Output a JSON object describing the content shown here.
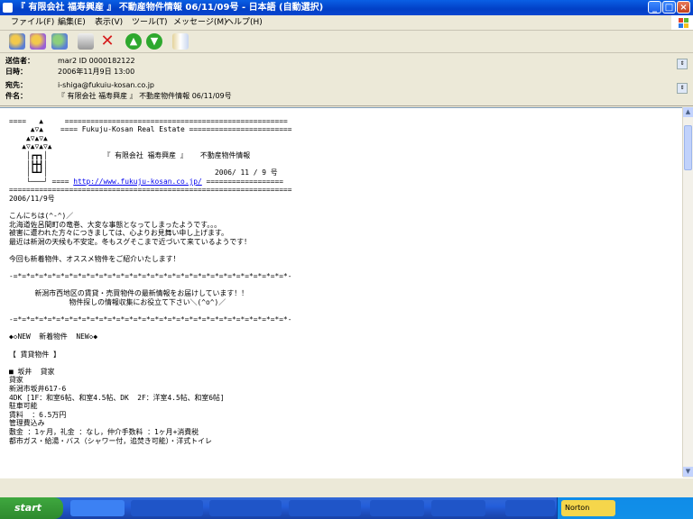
{
  "window": {
    "title": "『 有限会社 福寿興産 』 不動産物件情報 06/11/09号 - 日本語 (自動選択)"
  },
  "menu": [
    "ファイル(F)",
    "編集(E)",
    "表示(V)",
    "ツール(T)",
    "メッセージ(M)",
    "ヘルプ(H)"
  ],
  "header": {
    "from_label": "送信者：",
    "from_value": "mar2 ID 0000182122",
    "date_label": "日時：",
    "date_value": "2006年11月9日 13:00",
    "to_label": "宛先：",
    "to_value": "i-shiga@fukuiu-kosan.co.jp",
    "subject_label": "件名：",
    "subject_value": "『 有限会社 福寿興産 』 不動産物件情報 06/11/09号"
  },
  "body": {
    "lines": [
      "",
      "====   ▲     ====================================================",
      "     ▲▽▲    ==== Fukuju-Kosan Real Estate ========================",
      "    ▲▽▲▽▲",
      "   ▲▽▲▽▲▽▲",
      "    │┏┳┓│             『 有限会社 福寿興産 』   不動産物件情報",
      "    │┣╋┫│",
      "    │┗┻┛│                                       2006/ 11 / 9 号",
      "    └───┘ ==== ",
      "==================================================================",
      "2006/11/9号",
      "",
      "こんにちは(^-^)／",
      "北海道佐呂間町の竜巻、大変な事態となってしまったようです。。。",
      "被害に遭われた方々につきましては、心よりお見舞い申し上げます。",
      "最近は新潟の天候も不安定。冬もスグそこまで近づいて来ているようです！",
      "",
      "今回も新着物件、オススメ物件をご紹介いたします！",
      "",
      "-=*=*=*=*=*=*=*=*=*=*=*=*=*=*=*=*=*=*=*=*=*=*=*=*=*=*=*=*=*=*=*=*-",
      "",
      "      新潟市西地区の賃貸・売買物件の最新情報をお届けしています！！",
      "              物件探しの情報収集にお役立て下さい＼(^o^)／",
      "",
      "-=*=*=*=*=*=*=*=*=*=*=*=*=*=*=*=*=*=*=*=*=*=*=*=*=*=*=*=*=*=*=*=*-",
      "",
      "◆◇NEW  新着物件  NEW◇◆",
      "",
      "【 賃貸物件 】",
      "",
      "■ 坂井  貸家",
      "貸家",
      "新潟市坂井617-6",
      "4DK [1F：和室6帖、和室4.5帖、DK  2F：洋室4.5帖、和室6帖]",
      "駐車可能",
      "賃料  ：6.5万円",
      "管理費込み",
      "敷金 ：1ヶ月，礼金 ：なし，仲介手数料 ：1ヶ月+消費税",
      "都市ガス・給湯・バス（シャワー付，追焚き可能）・洋式トイレ"
    ],
    "link_line_prefix": "    └───┘ ==== ",
    "link_text": "http://www.fukuju-kosan.co.jp/",
    "link_line_suffix": " =================="
  },
  "taskbar": {
    "start_label": "start",
    "tray_item": "Norton"
  }
}
